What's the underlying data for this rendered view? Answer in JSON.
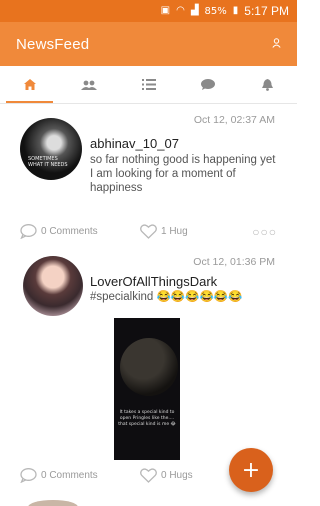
{
  "status_bar": {
    "battery": "85%",
    "time": "5:17 PM"
  },
  "app_bar": {
    "title": "NewsFeed",
    "user_icon": "user-icon"
  },
  "tabs": [
    {
      "icon": "home-icon",
      "active": true
    },
    {
      "icon": "group-icon",
      "active": false
    },
    {
      "icon": "list-icon",
      "active": false
    },
    {
      "icon": "chat-icon",
      "active": false
    },
    {
      "icon": "bell-icon",
      "active": false
    }
  ],
  "posts": [
    {
      "time": "Oct 12, 02:37 AM",
      "username": "abhinav_10_07",
      "content": "so far nothing good is happening yet I am looking for a moment of happiness",
      "comments_label": "0 Comments",
      "hugs_label": "1 Hug",
      "avatar_text": [
        "SOMETIMES",
        "WHAT IT NEEDS"
      ]
    },
    {
      "time": "Oct 12, 01:36 PM",
      "username": "LoverOfAllThingsDark",
      "content": "#specialkind 😂😂😂😂😂😂",
      "comments_label": "0 Comments",
      "hugs_label": "0 Hugs",
      "media_caption": "It takes a special kind to open Pringles like the.... that special kind is me 😂"
    }
  ],
  "fab": {
    "label": "+"
  },
  "colors": {
    "primary": "#f0893a",
    "status_bar": "#e8731e",
    "fab": "#d9611c"
  }
}
